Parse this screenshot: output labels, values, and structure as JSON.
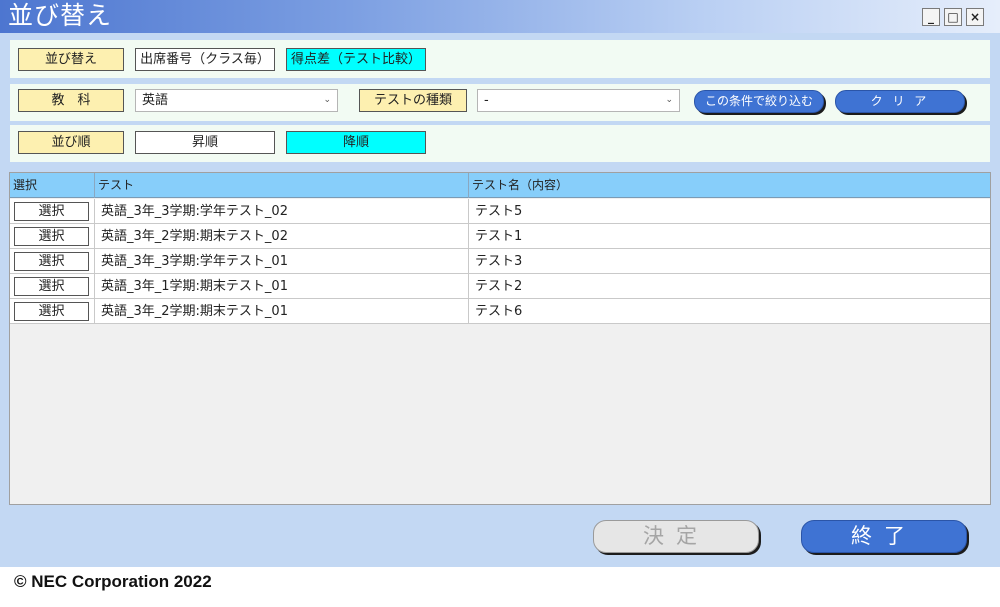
{
  "window": {
    "title": "並び替え"
  },
  "sort": {
    "label": "並び替え",
    "options": [
      {
        "label": "出席番号（クラス毎）",
        "active": false
      },
      {
        "label": "得点差（テスト比較）",
        "active": true
      }
    ]
  },
  "filter": {
    "subject_label": "教　科",
    "subject_value": "英語",
    "test_type_label": "テストの種類",
    "test_type_value": "-",
    "apply_label": "この条件で絞り込む",
    "clear_label": "ク リ ア"
  },
  "order": {
    "label": "並び順",
    "options": [
      {
        "label": "昇順",
        "active": false
      },
      {
        "label": "降順",
        "active": true
      }
    ]
  },
  "table": {
    "headers": [
      "選択",
      "テスト",
      "テスト名（内容）"
    ],
    "select_label": "選択",
    "rows": [
      {
        "test": "英語_3年_3学期:学年テスト_02",
        "name": "テスト5"
      },
      {
        "test": "英語_3年_2学期:期末テスト_02",
        "name": "テスト1"
      },
      {
        "test": "英語_3年_3学期:学年テスト_01",
        "name": "テスト3"
      },
      {
        "test": "英語_3年_1学期:期末テスト_01",
        "name": "テスト2"
      },
      {
        "test": "英語_3年_2学期:期末テスト_01",
        "name": "テスト6"
      }
    ]
  },
  "footer": {
    "decide_label": "決定",
    "end_label": "終了"
  },
  "copyright": "© NEC Corporation 2022",
  "colors": {
    "accent": "#3f73d3",
    "header": "#87cefa",
    "active": "#00ffff",
    "label_bg": "#fdf0b0"
  },
  "icons": [
    "minimize-icon",
    "maximize-icon",
    "close-icon",
    "chevron-down-icon"
  ]
}
